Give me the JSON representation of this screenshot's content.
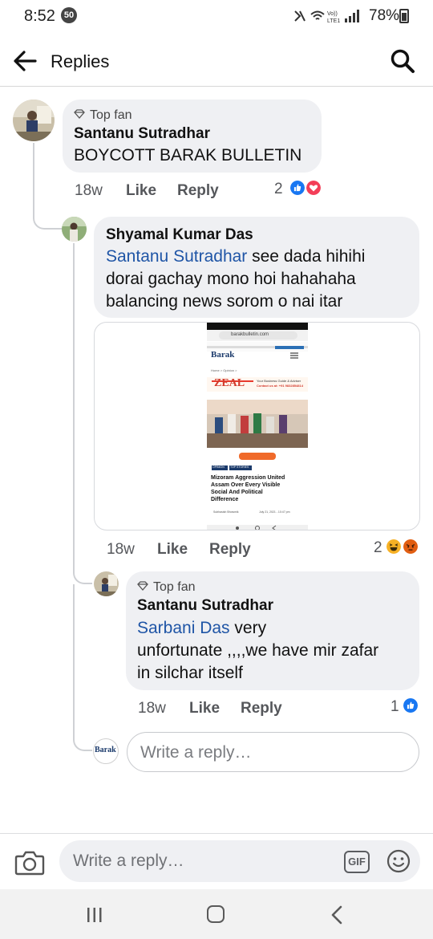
{
  "status_bar": {
    "time": "8:52",
    "notification_count": "50",
    "battery": "78%"
  },
  "header": {
    "title": "Replies"
  },
  "comments": [
    {
      "badge": "Top fan",
      "author": "Santanu Sutradhar",
      "text": "BOYCOTT BARAK BULLETIN",
      "time": "18w",
      "like": "Like",
      "reply": "Reply",
      "reaction_count": "2"
    },
    {
      "author": "Shyamal Kumar Das",
      "mention": "Santanu Sutradhar",
      "text_line1": " see dada hihihi",
      "text_line2": "dorai gachay mono hoi hahahaha",
      "text_line3": "balancing news sorom o nai itar",
      "time": "18w",
      "like": "Like",
      "reply": "Reply",
      "reaction_count": "2"
    },
    {
      "badge": "Top fan",
      "author": "Santanu Sutradhar",
      "mention": "Sarbani Das",
      "text_line1": " very",
      "text_line2": "unfortunate ,,,,we have mir zafar",
      "text_line3": "in silchar itself",
      "time": "18w",
      "like": "Like",
      "reply": "Reply",
      "reaction_count": "1"
    }
  ],
  "attachment": {
    "url_bar": "barakbulletin.com",
    "logo": "Barak",
    "ad_word": "ZEAL",
    "ad_text_line1": "Your Business Guide & Adviser",
    "ad_text_line2": "Contact us at: +91 9832854814",
    "breadcrumb": "Home > Opinion >",
    "tag1": "OPINION",
    "tag2": "TOP STORIES",
    "headline_line1": "Mizoram Aggression United",
    "headline_line2": "Assam Over Every Visible",
    "headline_line3": "Social And Political",
    "headline_line4": "Difference",
    "byline": "Subhasish Bhowmik",
    "date": "July 21, 2021 - 10:47 pm"
  },
  "reply_input": {
    "placeholder": "Write a reply…",
    "avatar_logo": "Barak"
  },
  "composer": {
    "placeholder": "Write a reply…",
    "gif_label": "GIF"
  },
  "colors": {
    "like_blue": "#1877f2",
    "love_red": "#f33e58",
    "haha_yellow": "#f7b125",
    "angry_orange": "#e9710f",
    "mention_blue": "#1f55a6",
    "bubble_bg": "#eff0f3"
  }
}
